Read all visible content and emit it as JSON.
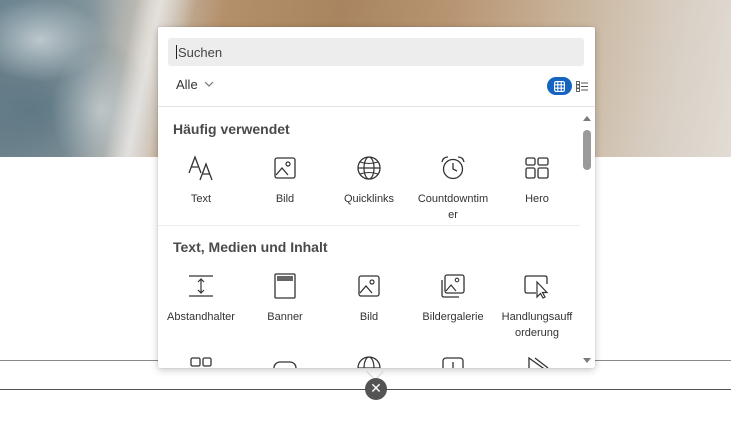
{
  "search": {
    "placeholder": "Suchen"
  },
  "filter": {
    "label": "Alle"
  },
  "view_toggle": {
    "active": "grid",
    "accent_color": "#1565c0"
  },
  "sections": [
    {
      "title": "Häufig verwendet",
      "items": [
        {
          "label": "Text",
          "icon": "text-icon"
        },
        {
          "label": "Bild",
          "icon": "image-icon"
        },
        {
          "label": "Quicklinks",
          "icon": "globe-icon"
        },
        {
          "label": "Countdowntimer",
          "icon": "alarm-clock-icon"
        },
        {
          "label": "Hero",
          "icon": "hero-layout-icon"
        }
      ]
    },
    {
      "title": "Text, Medien und Inhalt",
      "items": [
        {
          "label": "Abstandhalter",
          "icon": "spacer-icon"
        },
        {
          "label": "Banner",
          "icon": "banner-icon"
        },
        {
          "label": "Bild",
          "icon": "image-icon"
        },
        {
          "label": "Bildergalerie",
          "icon": "image-gallery-icon"
        },
        {
          "label": "Handlungsaufforderung",
          "icon": "call-to-action-icon"
        }
      ]
    }
  ],
  "close_button": {
    "glyph": "✕"
  }
}
